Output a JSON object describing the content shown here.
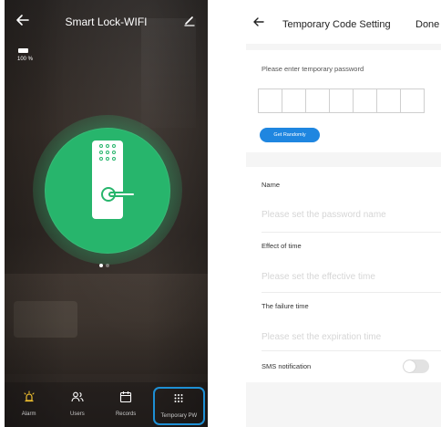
{
  "lock_screen": {
    "title": "Smart Lock-WIFI",
    "battery_percent": "100 %",
    "nav": [
      {
        "label": "Alarm",
        "icon": "alarm-icon"
      },
      {
        "label": "Users",
        "icon": "users-icon"
      },
      {
        "label": "Records",
        "icon": "calendar-icon"
      },
      {
        "label": "Temporary PW",
        "icon": "keypad-icon"
      }
    ],
    "selected_nav": "Temporary PW",
    "page_indicator": {
      "pages": 2,
      "current": 1
    }
  },
  "code_screen": {
    "title": "Temporary Code Setting",
    "done_label": "Done",
    "password_prompt": "Please enter temporary password",
    "password_digits": [
      "",
      "",
      "",
      "",
      "",
      "",
      ""
    ],
    "random_button": "Get Randomly",
    "name_label": "Name",
    "name_placeholder": "Please set the password name",
    "effect_label": "Effect of time",
    "effect_placeholder": "Please set the effective time",
    "failure_label": "The failure time",
    "failure_placeholder": "Please set the expiration time",
    "sms_label": "SMS notification",
    "sms_enabled": false
  },
  "colors": {
    "accent_green": "#27b56c",
    "accent_blue": "#1f86e0",
    "selection_border": "#1e8fd4",
    "nav_alarm_yellow": "#f2c230"
  }
}
